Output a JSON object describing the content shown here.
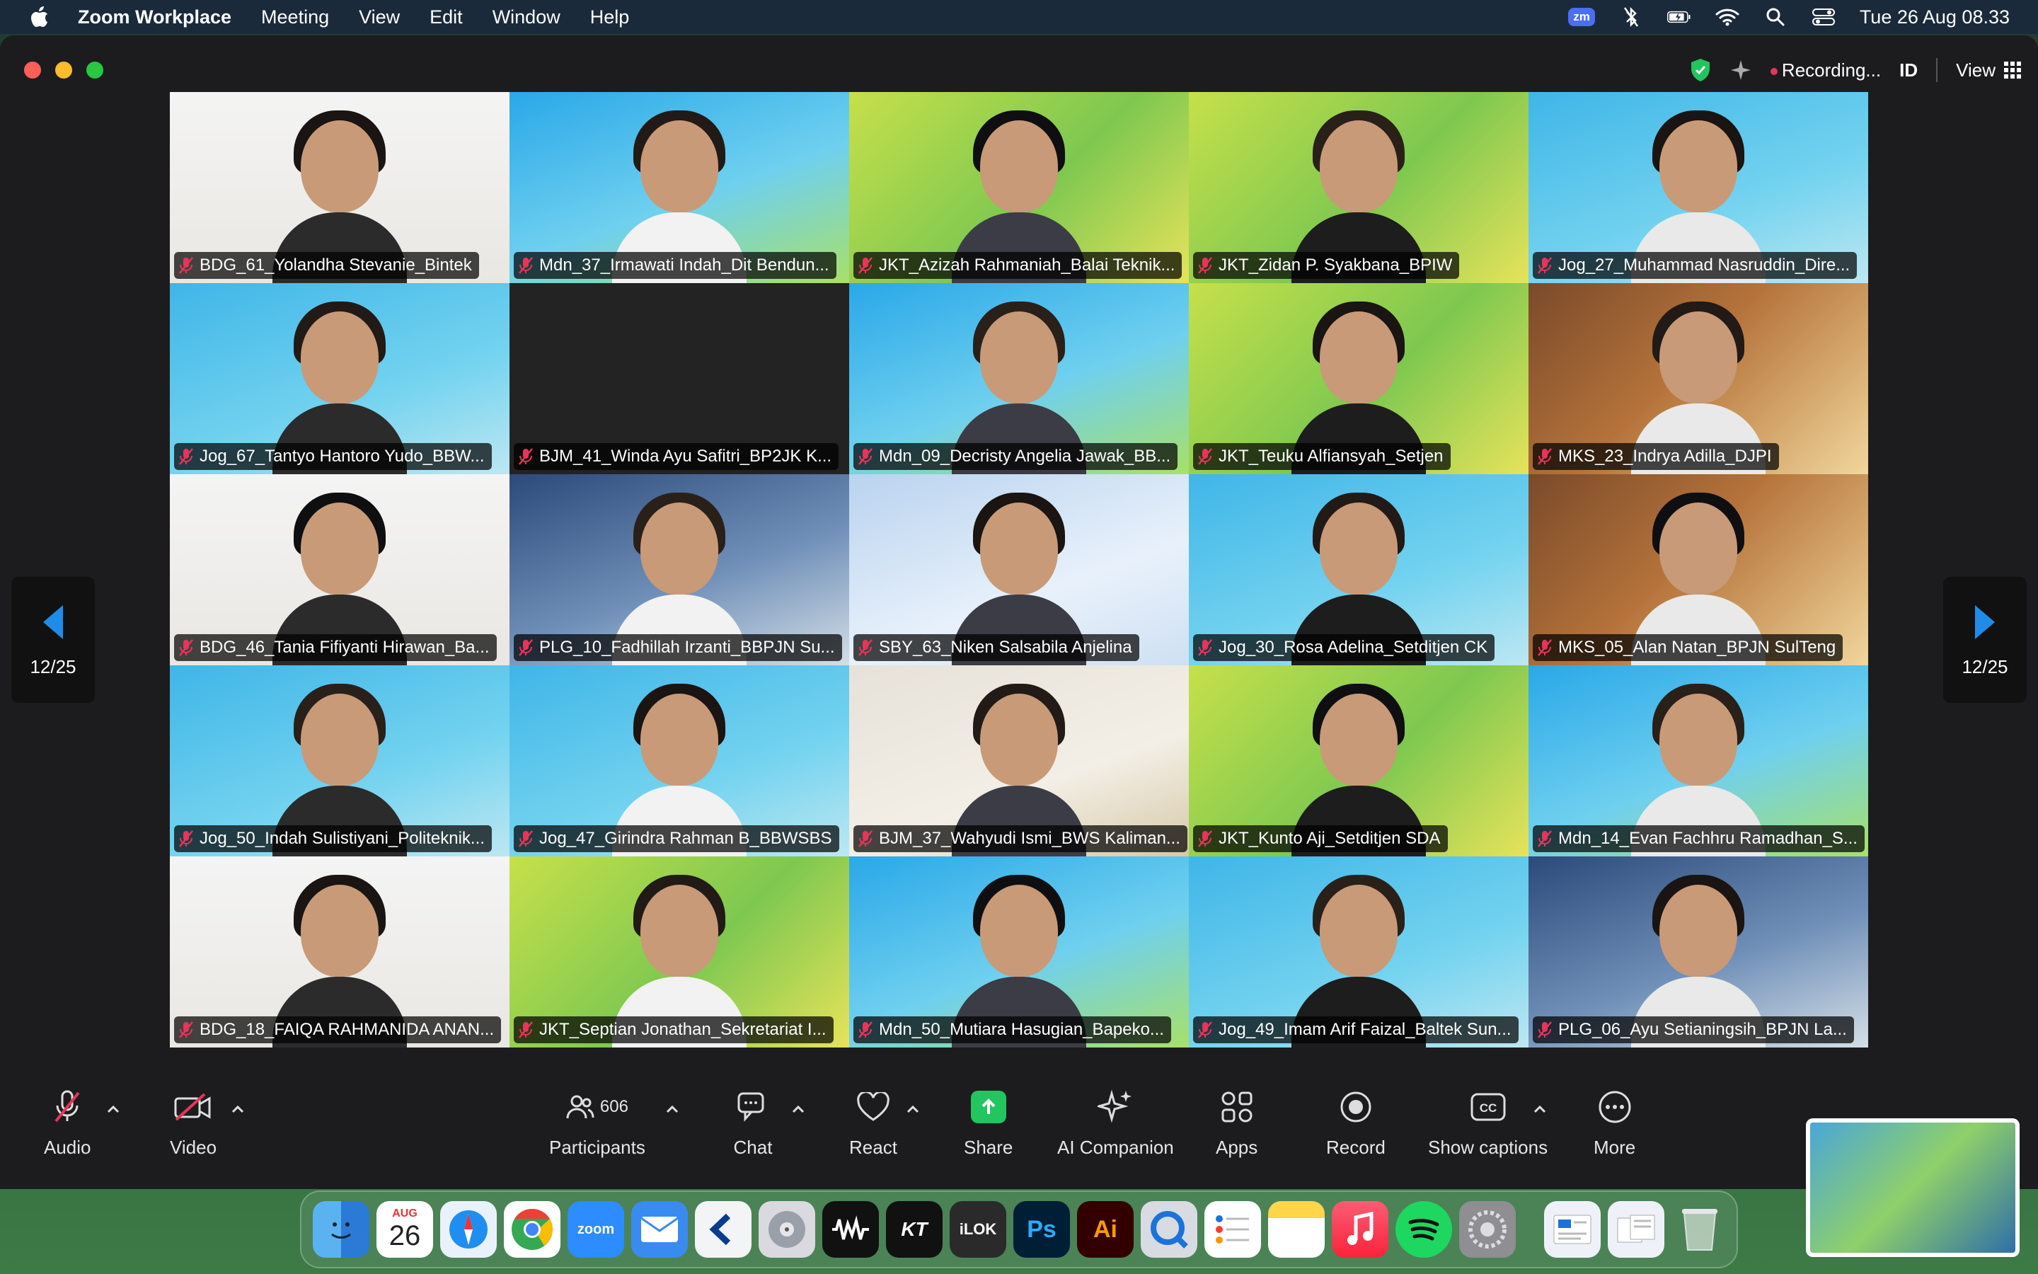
{
  "menubar": {
    "app_name": "Zoom Workplace",
    "menus": [
      "Meeting",
      "View",
      "Edit",
      "Window",
      "Help"
    ],
    "zoom_badge": "zm",
    "datetime": "Tue 26 Aug  08.33"
  },
  "titlebar": {
    "recording_label": "Recording...",
    "language": "ID",
    "view_label": "View"
  },
  "pager": {
    "left": "12/25",
    "right": "12/25"
  },
  "participants": [
    {
      "name": "BDG_61_Yolandha Stevanie_Bintek",
      "bg": "pu_white"
    },
    {
      "name": "Mdn_37_Irmawati Indah_Dit Bendun...",
      "bg": "pu_blue"
    },
    {
      "name": "JKT_Azizah Rahmaniah_Balai Teknik...",
      "bg": "peserta_green"
    },
    {
      "name": "JKT_Zidan P. Syakbana_BPIW",
      "bg": "peserta_green"
    },
    {
      "name": "Jog_27_Muhammad Nasruddin_Dire...",
      "bg": "tugu"
    },
    {
      "name": "Jog_67_Tantyo Hantoro Yudo_BBW...",
      "bg": "tugu"
    },
    {
      "name": "BJM_41_Winda Ayu Safitri_BP2JK K...",
      "bg": "empty"
    },
    {
      "name": "Mdn_09_Decristy Angelia Jawak_BB...",
      "bg": "pu_blue"
    },
    {
      "name": "JKT_Teuku Alfiansyah_Setjen",
      "bg": "peserta_green"
    },
    {
      "name": "MKS_23_Indrya Adilla_DJPI",
      "bg": "mks_brown"
    },
    {
      "name": "BDG_46_Tania Fifiyanti Hirawan_Ba...",
      "bg": "pu_white"
    },
    {
      "name": "PLG_10_Fadhillah Irzanti_BBPJN Su...",
      "bg": "plg_navy"
    },
    {
      "name": "SBY_63_Niken Salsabila Anjelina",
      "bg": "sby_light"
    },
    {
      "name": "Jog_30_Rosa Adelina_Setditjen CK",
      "bg": "tugu"
    },
    {
      "name": "MKS_05_Alan Natan_BPJN SulTeng",
      "bg": "mks_brown"
    },
    {
      "name": "Jog_50_Indah Sulistiyani_Politeknik...",
      "bg": "tugu"
    },
    {
      "name": "Jog_47_Girindra Rahman B_BBWSBS",
      "bg": "tugu"
    },
    {
      "name": "BJM_37_Wahyudi Ismi_BWS Kaliman...",
      "bg": "bjm_beige"
    },
    {
      "name": "JKT_Kunto Aji_Setditjen SDA",
      "bg": "peserta_green"
    },
    {
      "name": "Mdn_14_Evan Fachhru Ramadhan_S...",
      "bg": "pu_blue"
    },
    {
      "name": "BDG_18_FAIQA RAHMANIDA ANAN...",
      "bg": "pu_white"
    },
    {
      "name": "JKT_Septian Jonathan_Sekretariat I...",
      "bg": "peserta_green"
    },
    {
      "name": "Mdn_50_Mutiara Hasugian_Bapeko...",
      "bg": "pu_blue"
    },
    {
      "name": "Jog_49_Imam Arif Faizal_Baltek Sun...",
      "bg": "tugu"
    },
    {
      "name": "PLG_06_Ayu Setianingsih_BPJN La...",
      "bg": "plg_navy"
    }
  ],
  "controls": {
    "audio": "Audio",
    "video": "Video",
    "participants": "Participants",
    "participants_count": "606",
    "chat": "Chat",
    "react": "React",
    "share": "Share",
    "ai_companion": "AI Companion",
    "apps": "Apps",
    "record": "Record",
    "show_captions": "Show captions",
    "more": "More"
  },
  "dock": {
    "apps": [
      "Finder",
      "Calendar",
      "Safari",
      "Chrome",
      "Zoom",
      "Mail",
      "Copilot",
      "Disk Utility",
      "Waveform",
      "KT",
      "ILOK",
      "Photoshop",
      "Illustrator",
      "QuickTime",
      "Reminders",
      "Notes",
      "Music",
      "Spotify",
      "Settings",
      "Preview",
      "Documents",
      "Trash"
    ],
    "calendar_month": "AUG",
    "calendar_day": "26",
    "zoom_label": "zoom",
    "kt_label": "KT",
    "ilok_label": "iLOK",
    "ps_label": "Ps",
    "ai_label": "Ai"
  },
  "colors": {
    "accent_green": "#22c55e",
    "record_red": "#e8345a",
    "window_bg": "#1c1c1e"
  }
}
